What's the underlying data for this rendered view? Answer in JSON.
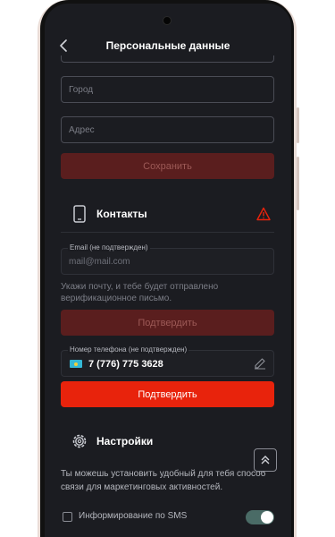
{
  "header": {
    "title": "Персональные данные"
  },
  "address_form": {
    "city_placeholder": "Город",
    "address_placeholder": "Адрес",
    "save_label": "Сохранить"
  },
  "contacts": {
    "title": "Контакты",
    "email": {
      "label": "Email (не подтвержден)",
      "value": "mail@mail.com",
      "hint": "Укажи почту, и тебе будет отправлено верификационное письмо.",
      "confirm_label": "Подтвердить"
    },
    "phone": {
      "label": "Номер телефона (не подтвержден)",
      "value": "7 (776) 775 3628",
      "country_flag_icon": "kazakhstan-flag-icon",
      "confirm_label": "Подтвердить"
    }
  },
  "settings": {
    "title": "Настройки",
    "description": "Ты можешь установить удобный для тебя способ связи для маркетинговых активностей.",
    "sms_label": "Информирование по SMS",
    "sms_enabled": true
  },
  "colors": {
    "background": "#1b1c21",
    "accent": "#e8230c",
    "accent_disabled": "#5a1e1e",
    "warning": "#e8230c",
    "toggle_on": "#4a6b66"
  }
}
